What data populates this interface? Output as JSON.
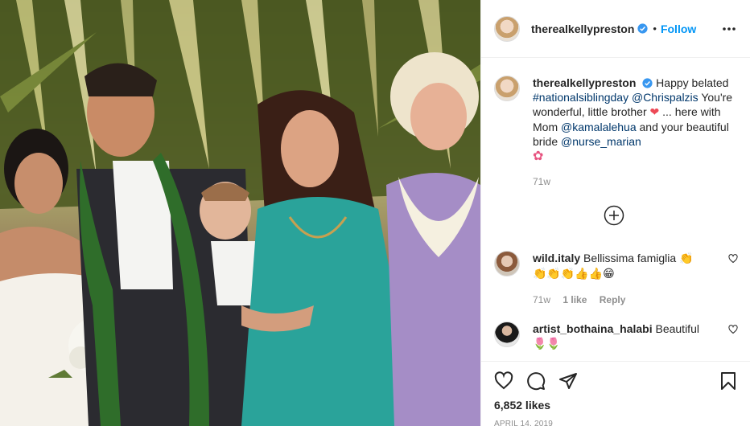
{
  "post": {
    "photo_description": "",
    "header": {
      "username": "therealkellypreston",
      "separator": "•",
      "follow_label": "Follow"
    },
    "caption": {
      "username": "therealkellypreston",
      "text_1": "Happy belated",
      "hashtag": "#nationalsiblingday",
      "mention_1": "@Chrispalzis",
      "text_2": "You're wonderful, little brother",
      "emoji_1": "❤",
      "text_3": "... here with Mom",
      "mention_2": "@kamalalehua",
      "text_4": "and your beautiful bride",
      "mention_3": "@nurse_marian",
      "emoji_2": "✿",
      "time": "71w"
    },
    "comments": [
      {
        "username": "wild.italy",
        "text": "Bellissima famiglia",
        "emoji_line_1": "👏",
        "emoji_line_2": "👏👏👏👍👍😁",
        "time": "71w",
        "likes": "1 like",
        "reply": "Reply"
      },
      {
        "username": "artist_bothaina_halabi",
        "text": "Beautiful",
        "emoji_line_2": "🌷🌷"
      }
    ],
    "actions": {
      "likes": "6,852 likes",
      "date": "APRIL 14, 2019"
    }
  },
  "colors": {
    "link_blue": "#0095f6",
    "mention_blue": "#00376b",
    "text": "#262626",
    "muted": "#8e8e8e",
    "heart_red": "#ed4956",
    "flower_pink": "#e75480"
  },
  "icons": [
    "verified-badge-icon",
    "more-options-icon",
    "add-comment-icon",
    "heart-icon",
    "comment-icon",
    "share-icon",
    "bookmark-icon"
  ]
}
